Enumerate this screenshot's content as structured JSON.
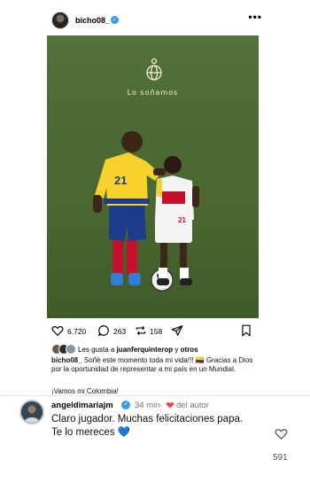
{
  "post": {
    "username": "bicho08_",
    "verified_mark": "✓",
    "more_icon": "•••",
    "image": {
      "tagline": "Lo soñamos",
      "jersey_number_adult": "21",
      "jersey_number_child": "21"
    },
    "actions": {
      "likes": "6.720",
      "comments": "263",
      "reposts": "158"
    },
    "liked_by": {
      "prefix": "Les gusta a ",
      "user": "juanferquinterop",
      "middle": " y ",
      "others": "otros"
    },
    "caption": {
      "username": "bicho08_",
      "text": " Soñé este momento toda mi vida!!! 🇨🇴 Gracias a Dios por la oportunidad de representar a mi país en un Mundial.",
      "second": "¡Vamos mi Colombia!"
    }
  },
  "comment": {
    "username": "angeldimariajm",
    "verified_mark": "✓",
    "time": "34 min",
    "dot": "·",
    "author_label": "del autor",
    "text": "Claro jugador. Muchas felicitaciones papa. Te lo mereces 💙",
    "like_count": "591"
  },
  "colors": {
    "verified": "#3897f0",
    "heart": "#ed4956",
    "meta": "#737373"
  }
}
